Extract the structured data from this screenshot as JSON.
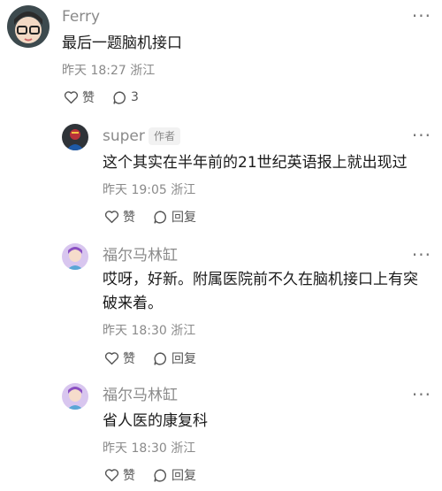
{
  "comments": [
    {
      "name": "Ferry",
      "text": "最后一题脑机接口",
      "time": "昨天 18:27",
      "location": "浙江",
      "like_label": "赞",
      "reply_count": "3"
    },
    {
      "name": "super",
      "badge": "作者",
      "text": "这个其实在半年前的21世纪英语报上就出现过",
      "time": "昨天 19:05",
      "location": "浙江",
      "like_label": "赞",
      "reply_label": "回复"
    },
    {
      "name": "福尔马林缸",
      "text_line1": "哎呀，好新。附属医院前不久在脑机接口上有突",
      "text_line2": "破来着。",
      "time": "昨天 18:30",
      "location": "浙江",
      "like_label": "赞",
      "reply_label": "回复"
    },
    {
      "name": "福尔马林缸",
      "text": "省人医的康复科",
      "time": "昨天 18:30",
      "location": "浙江",
      "like_label": "赞",
      "reply_label": "回复"
    }
  ],
  "more_glyph": "···"
}
